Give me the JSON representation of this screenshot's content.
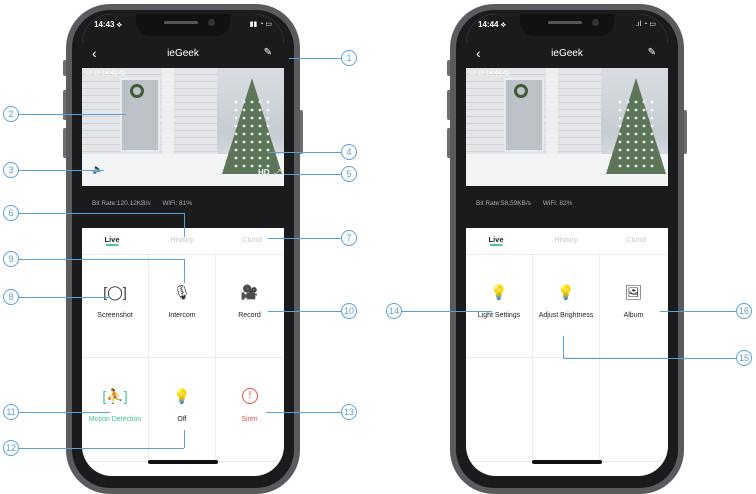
{
  "phone_left": {
    "status": {
      "time": "14:43 ⟡",
      "icons": "▮▮ ◔ ▭"
    },
    "nav": {
      "back": "‹",
      "title": "ieGeek",
      "edit": "✎"
    },
    "video": {
      "timestamp": "12-15 14:43:42",
      "speaker": "🔈",
      "hd": "HD",
      "fullscreen": "⤢"
    },
    "stats": {
      "bitrate": "Bit Rate:120.12KB/s",
      "wifi": "WiFi: 81%"
    },
    "tabs": [
      "Live",
      "History",
      "Cloud"
    ],
    "cells": [
      {
        "icon": "[◯]",
        "label": "Screenshot"
      },
      {
        "icon": "🎙",
        "label": "Intercom"
      },
      {
        "icon": "🎥",
        "label": "Record"
      },
      {
        "icon": "[⛹]",
        "label": "Motion Detection"
      },
      {
        "icon": "💡",
        "label": "Off"
      },
      {
        "icon": "!",
        "label": "Siren"
      }
    ]
  },
  "phone_right": {
    "status": {
      "time": "14:44 ⟡",
      "icons": ".ıl ◔ ▭"
    },
    "nav": {
      "back": "‹",
      "title": "ieGeek",
      "edit": "✎"
    },
    "video": {
      "timestamp": "12-15 14:44:42"
    },
    "stats": {
      "bitrate": "Bit Rate:58.59KB/s",
      "wifi": "WiFi: 82%"
    },
    "tabs": [
      "Live",
      "History",
      "Cloud"
    ],
    "cells": [
      {
        "icon": "💡",
        "label": "Light Settings"
      },
      {
        "icon": "💡",
        "label": "Adjust Brightness"
      },
      {
        "icon": "🖼",
        "label": "Album"
      }
    ]
  },
  "callouts": [
    "1",
    "2",
    "3",
    "4",
    "5",
    "6",
    "7",
    "8",
    "9",
    "10",
    "11",
    "12",
    "13",
    "14",
    "15",
    "16"
  ],
  "colors": {
    "accent": "#41c29c",
    "siren": "#e5524a",
    "callout": "#5aa0d8"
  }
}
